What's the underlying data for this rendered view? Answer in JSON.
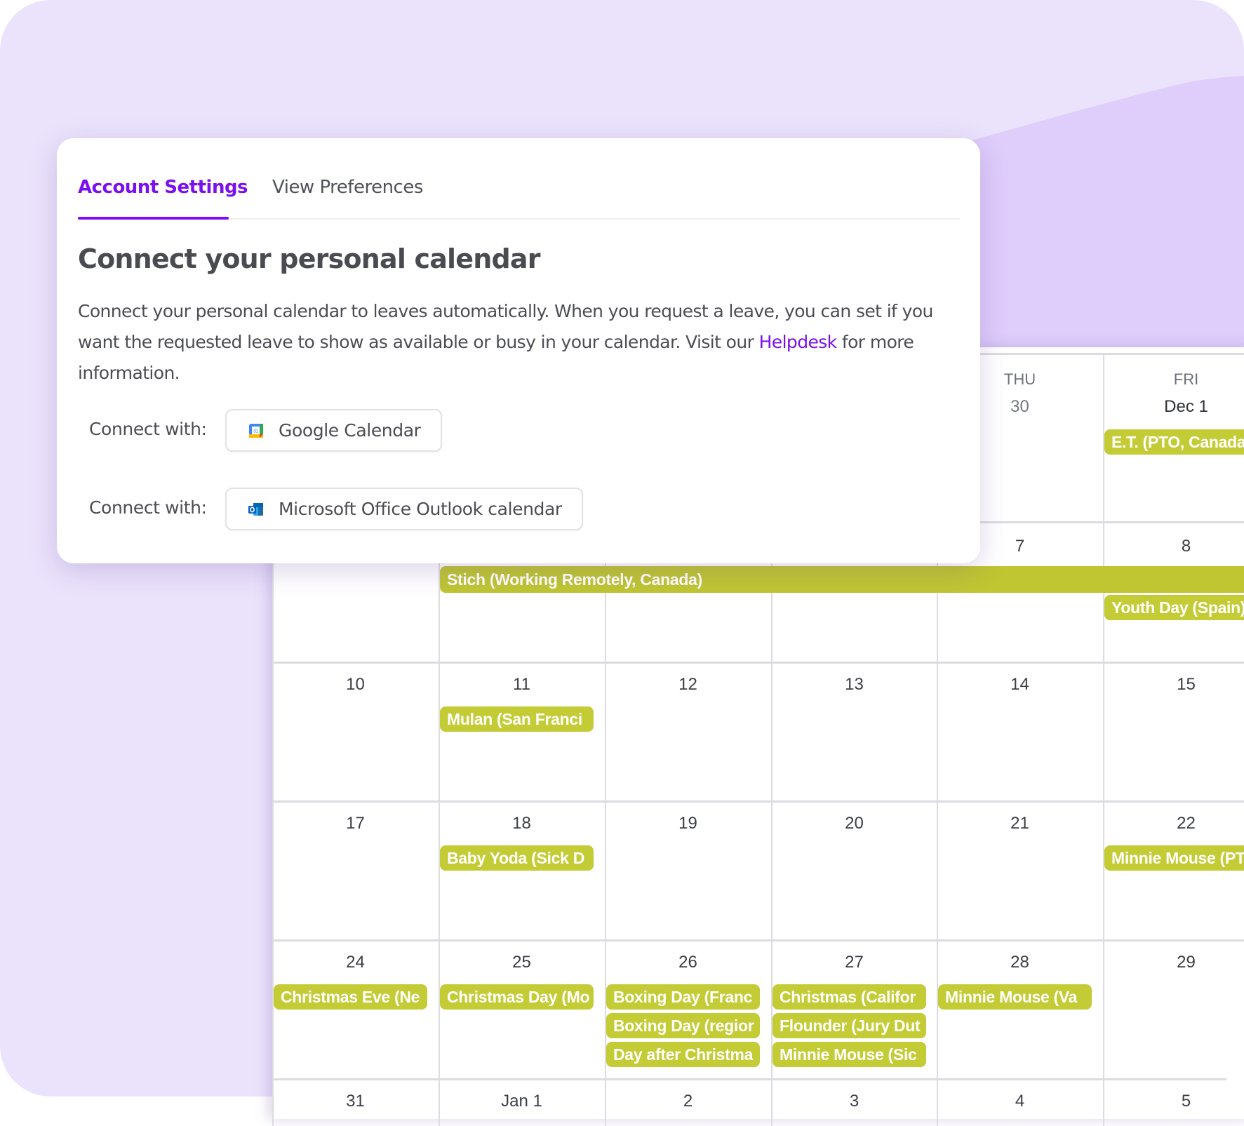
{
  "settings_card": {
    "tabs": [
      {
        "label": "Account Settings",
        "active": true
      },
      {
        "label": "View Preferences",
        "active": false
      }
    ],
    "title": "Connect your personal calendar",
    "description_part1": "Connect your personal calendar to leaves automatically. When you request a leave, you can set if you want the requested leave to show as available or busy in your calendar. Visit our ",
    "helpdesk_link": "Helpdesk",
    "description_part2": " for more information.",
    "connections": [
      {
        "label": "Connect with:",
        "button": "Google Calendar",
        "icon": "google-calendar-icon"
      },
      {
        "label": "Connect with:",
        "button": "Microsoft Office Outlook calendar",
        "icon": "outlook-icon"
      }
    ]
  },
  "calendar": {
    "colors": {
      "event": "#c3cb35",
      "accent": "#7a0ff0"
    },
    "visible_headers": [
      {
        "dow": "THU",
        "date": "30"
      },
      {
        "dow": "FRI",
        "date": "Dec 1"
      }
    ],
    "weeks": [
      {
        "days": [
          "",
          "",
          "",
          "",
          "7",
          "8"
        ]
      },
      {
        "days": [
          "10",
          "11",
          "12",
          "13",
          "14",
          "15"
        ]
      },
      {
        "days": [
          "17",
          "18",
          "19",
          "20",
          "21",
          "22"
        ]
      },
      {
        "days": [
          "24",
          "25",
          "26",
          "27",
          "28",
          "29"
        ]
      },
      {
        "days": [
          "31",
          "Jan 1",
          "2",
          "3",
          "4",
          "5"
        ]
      }
    ],
    "events": {
      "dec1": "E.T. (PTO, Canada",
      "stich": "Stich (Working Remotely, Canada)",
      "youth_day": "Youth Day (Spain)",
      "mulan": "Mulan (San Franci",
      "baby_yoda": "Baby Yoda (Sick D",
      "minnie22": "Minnie Mouse (PT",
      "christmas_eve": "Christmas Eve (Ne",
      "christmas_day": "Christmas Day (Mo",
      "boxing_france": "Boxing Day (Franc",
      "boxing_region": "Boxing Day (regior",
      "day_after": "Day after Christma",
      "christmas_calif": "Christmas (Califor",
      "flounder": "Flounder (Jury Dut",
      "minnie27": "Minnie Mouse (Sic",
      "minnie28": "Minnie Mouse (Va"
    }
  }
}
